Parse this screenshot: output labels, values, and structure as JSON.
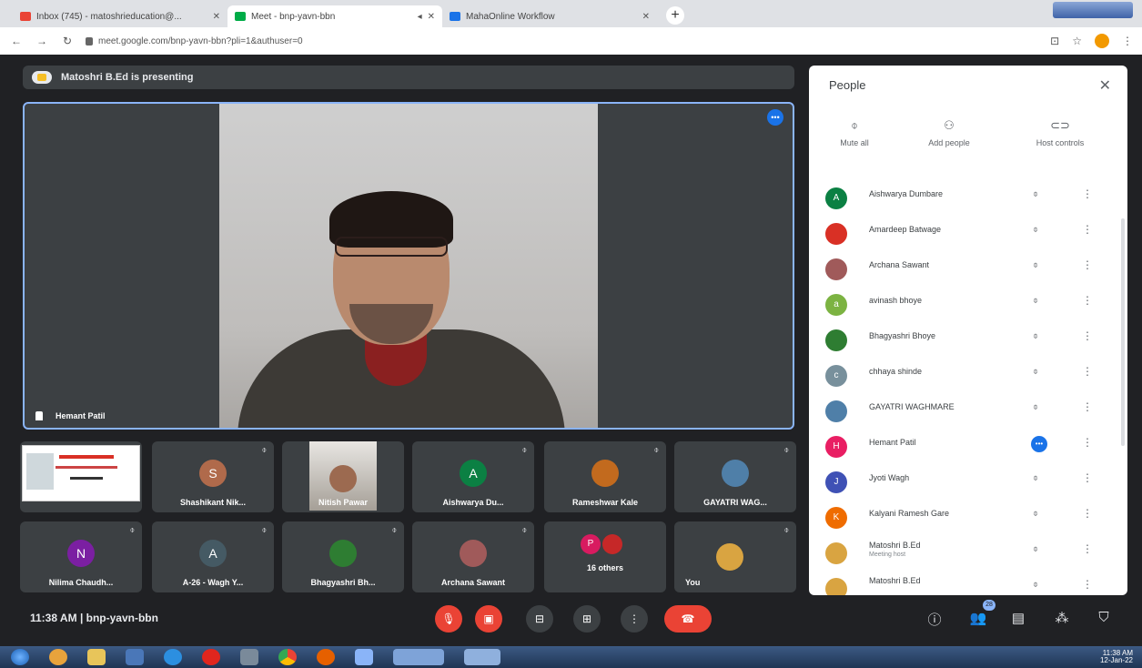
{
  "browser": {
    "tabs": [
      {
        "title": "Inbox (745) - matoshrieducation@...",
        "fav_color": "#ea4335",
        "active": false
      },
      {
        "title": "Meet - bnp-yavn-bbn",
        "fav_color": "#00ac47",
        "active": true
      },
      {
        "title": "MahaOnline Workflow",
        "fav_color": "#1a73e8",
        "active": false
      }
    ],
    "new_tab": "+",
    "url": "meet.google.com/bnp-yavn-bbn?pli=1&authuser=0"
  },
  "meet": {
    "presenting_text": "Matoshri B.Ed is presenting",
    "main_speaker": "Hemant Patil",
    "tiles": [
      {
        "name": "",
        "type": "slide"
      },
      {
        "name": "Shashikant Nik...",
        "type": "avatar",
        "initial": "S",
        "color": "#b06a4b"
      },
      {
        "name": "Nitish Pawar",
        "type": "camera"
      },
      {
        "name": "Aishwarya Du...",
        "type": "avatar",
        "initial": "A",
        "color": "#0b8043"
      },
      {
        "name": "Rameshwar Kale",
        "type": "photo",
        "initial": "",
        "color": "#c26a1e"
      },
      {
        "name": "GAYATRI WAG...",
        "type": "photo",
        "initial": "",
        "color": "#4f7fa8"
      },
      {
        "name": "Nilima Chaudh...",
        "type": "avatar",
        "initial": "N",
        "color": "#7b1fa2"
      },
      {
        "name": "A-26 - Wagh Y...",
        "type": "avatar",
        "initial": "A",
        "color": "#455a64"
      },
      {
        "name": "Bhagyashri Bh...",
        "type": "photo",
        "initial": "",
        "color": "#2e7d32"
      },
      {
        "name": "Archana Sawant",
        "type": "photo",
        "initial": "",
        "color": "#a05a5a"
      },
      {
        "name": "16 others",
        "type": "others",
        "initial": "P",
        "color": "#d81b60"
      },
      {
        "name": "You",
        "type": "photo",
        "initial": "",
        "color": "#d9a441"
      }
    ],
    "time": "11:38 AM",
    "meeting_code": "bnp-yavn-bbn",
    "participant_count": "28"
  },
  "people": {
    "title": "People",
    "close": "✕",
    "actions": {
      "mute_all": "Mute all",
      "add_people": "Add people",
      "host_controls": "Host controls"
    },
    "participants": [
      {
        "name": "Aishwarya Dumbare",
        "initial": "A",
        "color": "#0b8043",
        "sub": "",
        "speaking": false
      },
      {
        "name": "Amardeep Batwage",
        "initial": "",
        "color": "#d93025",
        "sub": "",
        "speaking": false
      },
      {
        "name": "Archana Sawant",
        "initial": "",
        "color": "#a05a5a",
        "sub": "",
        "speaking": false
      },
      {
        "name": "avinash bhoye",
        "initial": "a",
        "color": "#7cb342",
        "sub": "",
        "speaking": false
      },
      {
        "name": "Bhagyashri Bhoye",
        "initial": "",
        "color": "#2e7d32",
        "sub": "",
        "speaking": false
      },
      {
        "name": "chhaya shinde",
        "initial": "c",
        "color": "#78909c",
        "sub": "",
        "speaking": false
      },
      {
        "name": "GAYATRI WAGHMARE",
        "initial": "",
        "color": "#4f7fa8",
        "sub": "",
        "speaking": false
      },
      {
        "name": "Hemant Patil",
        "initial": "H",
        "color": "#e91e63",
        "sub": "",
        "speaking": true
      },
      {
        "name": "Jyoti Wagh",
        "initial": "J",
        "color": "#3f51b5",
        "sub": "",
        "speaking": false
      },
      {
        "name": "Kalyani Ramesh Gare",
        "initial": "K",
        "color": "#ef6c00",
        "sub": "",
        "speaking": false
      },
      {
        "name": "Matoshri B.Ed",
        "initial": "",
        "color": "#d9a441",
        "sub": "Meeting host",
        "speaking": false
      },
      {
        "name": "Matoshri B.Ed",
        "initial": "",
        "color": "#d9a441",
        "sub": "",
        "speaking": false
      }
    ]
  },
  "taskbar": {
    "tray_time": "11:38 AM",
    "tray_date": "12-Jan-22"
  }
}
